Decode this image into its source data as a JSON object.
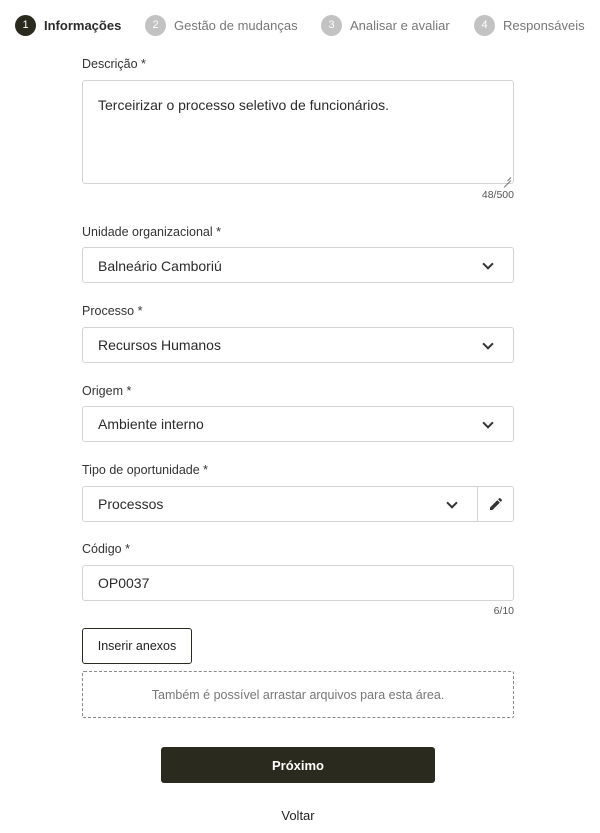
{
  "stepper": {
    "steps": [
      {
        "number": "1",
        "label": "Informações",
        "active": true
      },
      {
        "number": "2",
        "label": "Gestão de mudanças",
        "active": false
      },
      {
        "number": "3",
        "label": "Analisar e avaliar",
        "active": false
      },
      {
        "number": "4",
        "label": "Responsáveis",
        "active": false
      }
    ]
  },
  "form": {
    "descricao": {
      "label": "Descrição *",
      "value": "Terceirizar o processo seletivo de funcionários.",
      "counter": "48/500"
    },
    "unidade": {
      "label": "Unidade organizacional *",
      "value": "Balneário Camboriú",
      "icon": "chevron-down-icon"
    },
    "processo": {
      "label": "Processo *",
      "value": "Recursos Humanos",
      "icon": "chevron-down-icon"
    },
    "origem": {
      "label": "Origem *",
      "value": "Ambiente interno",
      "icon": "chevron-down-icon"
    },
    "tipo": {
      "label": "Tipo de oportunidade *",
      "value": "Processos",
      "icon": "chevron-down-icon",
      "edit_icon": "pencil-icon"
    },
    "codigo": {
      "label": "Código *",
      "value": "OP0037",
      "counter": "6/10"
    }
  },
  "attachments": {
    "button_label": "Inserir anexos",
    "dropzone_text": "Também é possível arrastar arquivos para esta área."
  },
  "actions": {
    "next_label": "Próximo",
    "back_label": "Voltar"
  },
  "colors": {
    "primary": "#2b2a1e",
    "step_inactive": "#c2c2c2",
    "border": "#d4d4d4"
  }
}
